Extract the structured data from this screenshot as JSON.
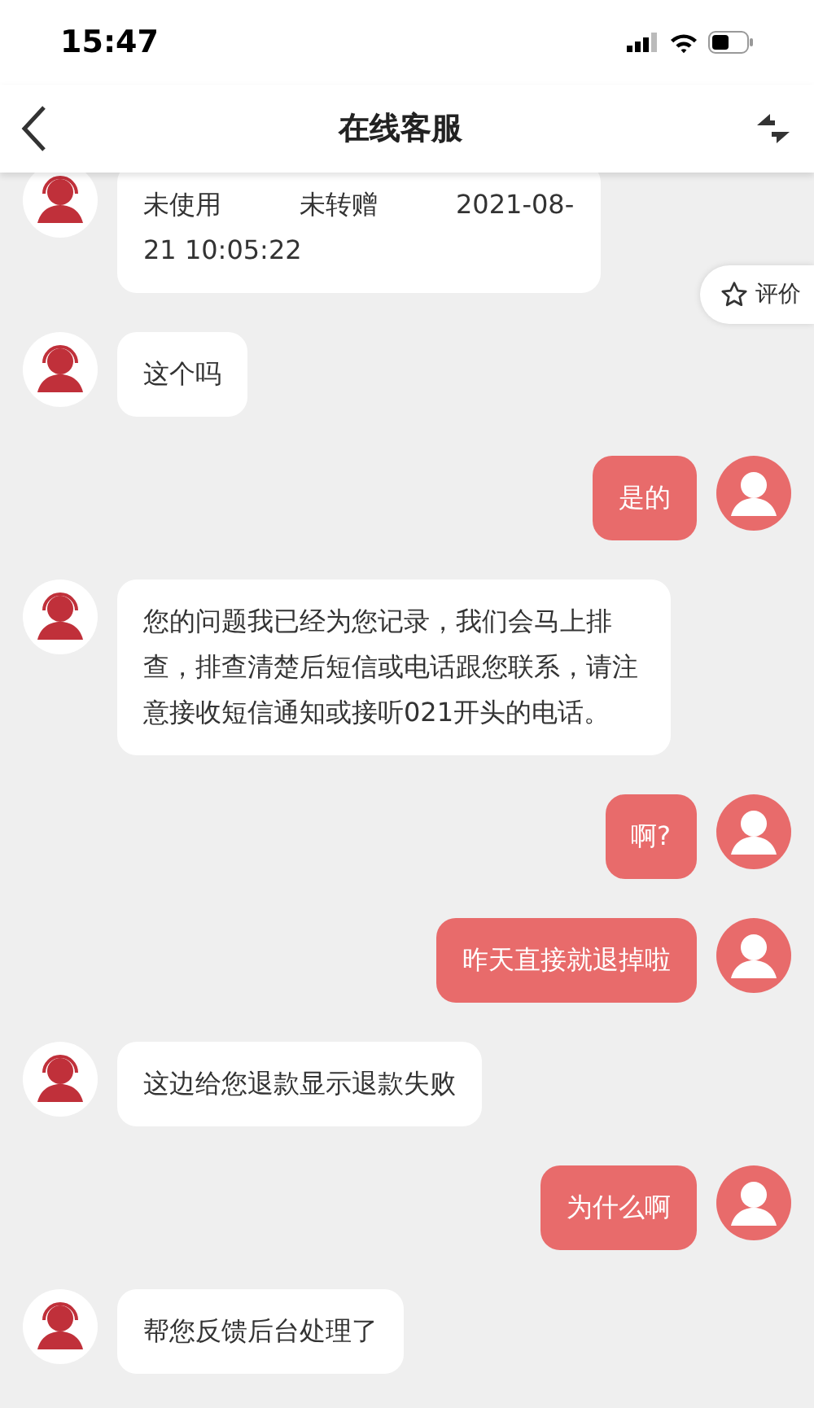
{
  "status_bar": {
    "time": "15:47"
  },
  "header": {
    "title": "在线客服"
  },
  "rating_button": {
    "label": "评价"
  },
  "messages": [
    {
      "kind": "agent",
      "lines": [
        "未使用　　　未转赠　　　2021-08-",
        "21 10:05:22"
      ]
    },
    {
      "kind": "agent",
      "lines": [
        "这个吗"
      ]
    },
    {
      "kind": "user",
      "lines": [
        "是的"
      ]
    },
    {
      "kind": "agent",
      "lines": [
        "您的问题我已经为您记录，我们会马上排查，排查清楚后短信或电话跟您联系，请注意接收短信通知或接听021开头的电话。"
      ]
    },
    {
      "kind": "user",
      "lines": [
        "啊?"
      ]
    },
    {
      "kind": "user",
      "lines": [
        "昨天直接就退掉啦"
      ]
    },
    {
      "kind": "agent",
      "lines": [
        "这边给您退款显示退款失败"
      ]
    },
    {
      "kind": "user",
      "lines": [
        "为什么啊"
      ]
    },
    {
      "kind": "agent",
      "lines": [
        "帮您反馈后台处理了"
      ]
    }
  ]
}
